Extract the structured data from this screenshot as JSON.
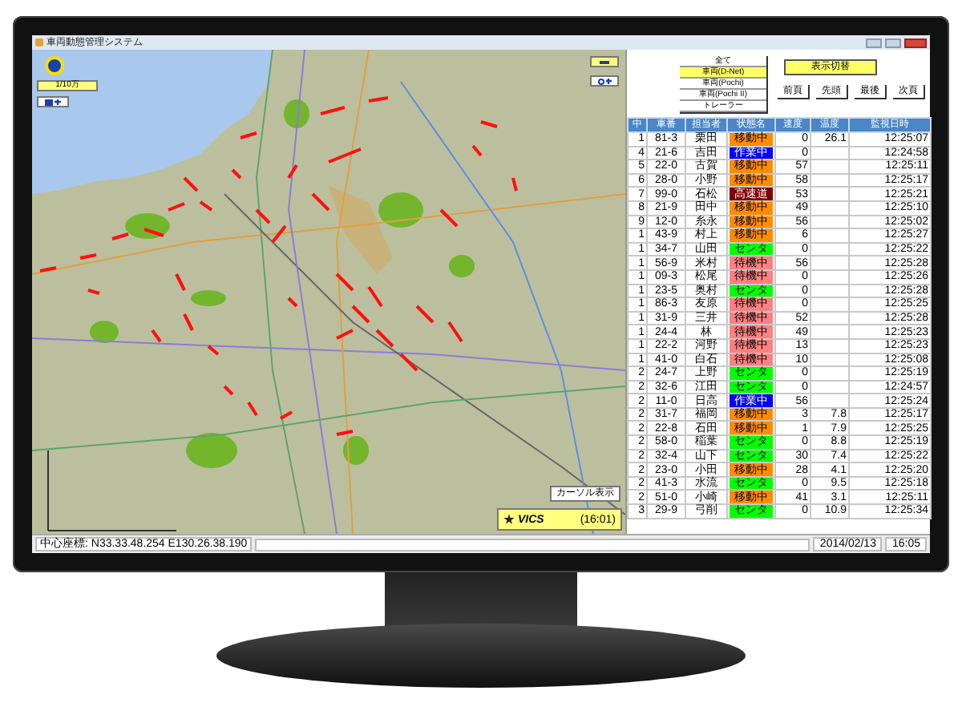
{
  "window": {
    "title": "車両動態管理システム"
  },
  "map": {
    "scale": "1/10万",
    "cursor_button": "カーソル表示",
    "vics": {
      "logo": "VICS",
      "time": "(16:01)"
    }
  },
  "filter_list": [
    {
      "label": "全て",
      "selected": false
    },
    {
      "label": "車両(D-Net)",
      "selected": true
    },
    {
      "label": "車両(Pochi)",
      "selected": false
    },
    {
      "label": "車両(Pochi II)",
      "selected": false
    },
    {
      "label": "トレーラー",
      "selected": false
    }
  ],
  "toggle_button": "表示切替",
  "paging_buttons": [
    "前頁",
    "先頭",
    "最後",
    "次頁"
  ],
  "table": {
    "columns": [
      "中",
      "車番",
      "担当者",
      "状態名",
      "速度",
      "温度",
      "監視日時"
    ],
    "rows": [
      {
        "no": "1",
        "car": "81-3",
        "driver": "栗田",
        "status": "移動中",
        "color": "#ff8c00",
        "speed": "0",
        "temp": "26.1",
        "time": "12:25:07"
      },
      {
        "no": "4",
        "car": "21-6",
        "driver": "吉田",
        "status": "作業中",
        "color": "#0000ff",
        "speed": "0",
        "time": "12:24:58"
      },
      {
        "no": "5",
        "car": "22-0",
        "driver": "古賀",
        "status": "移動中",
        "color": "#ff8c00",
        "speed": "57",
        "time": "12:25:11"
      },
      {
        "no": "6",
        "car": "28-0",
        "driver": "小野",
        "status": "移動中",
        "color": "#ff8c00",
        "speed": "58",
        "time": "12:25:17"
      },
      {
        "no": "7",
        "car": "99-0",
        "driver": "石松",
        "status": "高速道",
        "color": "#800000",
        "speed": "53",
        "time": "12:25:21"
      },
      {
        "no": "8",
        "car": "21-9",
        "driver": "田中",
        "status": "移動中",
        "color": "#ff8c00",
        "speed": "49",
        "time": "12:25:10"
      },
      {
        "no": "9",
        "car": "12-0",
        "driver": "糸永",
        "status": "移動中",
        "color": "#ff8c00",
        "speed": "56",
        "time": "12:25:02"
      },
      {
        "no": "1",
        "car": "43-9",
        "driver": "村上",
        "status": "移動中",
        "color": "#ff8c00",
        "speed": "6",
        "time": "12:25:27"
      },
      {
        "no": "1",
        "car": "34-7",
        "driver": "山田",
        "status": "センタ",
        "color": "#00ff00",
        "speed": "0",
        "time": "12:25:22"
      },
      {
        "no": "1",
        "car": "56-9",
        "driver": "米村",
        "status": "待機中",
        "color": "#ff8080",
        "speed": "56",
        "time": "12:25:28"
      },
      {
        "no": "1",
        "car": "09-3",
        "driver": "松尾",
        "status": "待機中",
        "color": "#ff8080",
        "speed": "0",
        "time": "12:25:26"
      },
      {
        "no": "1",
        "car": "23-5",
        "driver": "奥村",
        "status": "センタ",
        "color": "#00ff00",
        "speed": "0",
        "time": "12:25:28"
      },
      {
        "no": "1",
        "car": "86-3",
        "driver": "友原",
        "status": "待機中",
        "color": "#ff8080",
        "speed": "0",
        "time": "12:25:25"
      },
      {
        "no": "1",
        "car": "31-9",
        "driver": "三井",
        "status": "待機中",
        "color": "#ff8080",
        "speed": "52",
        "time": "12:25:28"
      },
      {
        "no": "1",
        "car": "24-4",
        "driver": "林",
        "status": "待機中",
        "color": "#ff8080",
        "speed": "49",
        "time": "12:25:23"
      },
      {
        "no": "1",
        "car": "22-2",
        "driver": "河野",
        "status": "待機中",
        "color": "#ff8080",
        "speed": "13",
        "time": "12:25:23"
      },
      {
        "no": "1",
        "car": "41-0",
        "driver": "白石",
        "status": "待機中",
        "color": "#ff8080",
        "speed": "10",
        "time": "12:25:08"
      },
      {
        "no": "2",
        "car": "24-7",
        "driver": "上野",
        "status": "センタ",
        "color": "#00ff00",
        "speed": "0",
        "time": "12:25:19"
      },
      {
        "no": "2",
        "car": "32-6",
        "driver": "江田",
        "status": "センタ",
        "color": "#00ff00",
        "speed": "0",
        "time": "12:24:57"
      },
      {
        "no": "2",
        "car": "11-0",
        "driver": "日高",
        "status": "作業中",
        "color": "#0000ff",
        "speed": "56",
        "time": "12:25:24"
      },
      {
        "no": "2",
        "car": "31-7",
        "driver": "福岡",
        "status": "移動中",
        "color": "#ff8c00",
        "speed": "3",
        "temp": "7.8",
        "time": "12:25:17"
      },
      {
        "no": "2",
        "car": "22-8",
        "driver": "石田",
        "status": "移動中",
        "color": "#ff8c00",
        "speed": "1",
        "temp": "7.9",
        "time": "12:25:25"
      },
      {
        "no": "2",
        "car": "58-0",
        "driver": "稲葉",
        "status": "センタ",
        "color": "#00ff00",
        "speed": "0",
        "temp": "8.8",
        "time": "12:25:19"
      },
      {
        "no": "2",
        "car": "32-4",
        "driver": "山下",
        "status": "センタ",
        "color": "#00ff00",
        "speed": "30",
        "temp": "7.4",
        "time": "12:25:22"
      },
      {
        "no": "2",
        "car": "23-0",
        "driver": "小田",
        "status": "移動中",
        "color": "#ff8c00",
        "speed": "28",
        "temp": "4.1",
        "time": "12:25:20"
      },
      {
        "no": "2",
        "car": "41-3",
        "driver": "水流",
        "status": "センタ",
        "color": "#00ff00",
        "speed": "0",
        "temp": "9.5",
        "time": "12:25:18"
      },
      {
        "no": "2",
        "car": "51-0",
        "driver": "小崎",
        "status": "移動中",
        "color": "#ff8c00",
        "speed": "41",
        "temp": "3.1",
        "time": "12:25:11"
      },
      {
        "no": "3",
        "car": "29-9",
        "driver": "弓削",
        "status": "センタ",
        "color": "#00ff00",
        "speed": "0",
        "temp": "10.9",
        "time": "12:25:34"
      }
    ]
  },
  "status_bar": {
    "center_coordinates": "中心座標: N33.33.48.254 E130.26.38.190",
    "date": "2014/02/13",
    "time": "16:05"
  }
}
